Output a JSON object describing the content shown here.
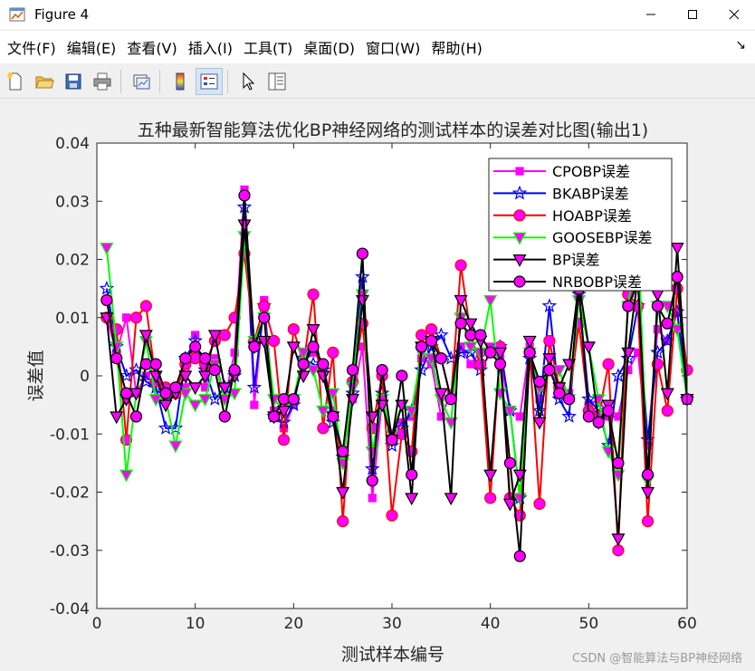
{
  "window": {
    "title": "Figure 4"
  },
  "menu": [
    "文件(F)",
    "编辑(E)",
    "查看(V)",
    "插入(I)",
    "工具(T)",
    "桌面(D)",
    "窗口(W)",
    "帮助(H)"
  ],
  "toolbar_icons": [
    "new-figure-icon",
    "open-file-icon",
    "save-icon",
    "print-icon",
    "link-plot-icon",
    "colorbar-icon",
    "legend-icon",
    "pointer-icon",
    "property-inspector-icon"
  ],
  "watermark": "CSDN @智能算法与BP神经网络",
  "chart_data": {
    "type": "line",
    "title": "五种最新智能算法优化BP神经网络的测试样本的误差对比图(输出1)",
    "xlabel": "测试样本编号",
    "ylabel": "误差值",
    "xlim": [
      0,
      60
    ],
    "ylim": [
      -0.04,
      0.04
    ],
    "xticks": [
      0,
      10,
      20,
      30,
      40,
      50,
      60
    ],
    "yticks": [
      -0.04,
      -0.03,
      -0.02,
      -0.01,
      0,
      0.01,
      0.02,
      0.03,
      0.04
    ],
    "ytick_labels": [
      "-0.04",
      "-0.03",
      "-0.02",
      "-0.01",
      "0",
      "0.01",
      "0.02",
      "0.03",
      "0.04"
    ],
    "grid": false,
    "legend_position": "top-right",
    "x": [
      1,
      2,
      3,
      4,
      5,
      6,
      7,
      8,
      9,
      10,
      11,
      12,
      13,
      14,
      15,
      16,
      17,
      18,
      19,
      20,
      21,
      22,
      23,
      24,
      25,
      26,
      27,
      28,
      29,
      30,
      31,
      32,
      33,
      34,
      35,
      36,
      37,
      38,
      39,
      40,
      41,
      42,
      43,
      44,
      45,
      46,
      47,
      48,
      49,
      50,
      51,
      52,
      53,
      54,
      55,
      56,
      57,
      58,
      59,
      60
    ],
    "series": [
      {
        "name": "CPOBP误差",
        "color": "#ff00ff",
        "marker": "square",
        "marker_fill": "#ff00ff",
        "values": [
          0.01,
          0.004,
          0.01,
          -0.003,
          0.0,
          0.002,
          -0.004,
          -0.003,
          -0.002,
          0.007,
          -0.002,
          0.003,
          -0.004,
          0.004,
          0.032,
          -0.005,
          0.013,
          -0.006,
          -0.009,
          -0.005,
          0.004,
          0.004,
          0.002,
          -0.006,
          -0.014,
          -0.004,
          0.005,
          -0.021,
          -0.004,
          -0.011,
          -0.008,
          -0.007,
          0.003,
          0.002,
          -0.007,
          -0.003,
          0.005,
          0.002,
          0.004,
          0.005,
          0.003,
          -0.006,
          -0.007,
          0.005,
          -0.004,
          0.001,
          -0.002,
          -0.003,
          0.009,
          -0.005,
          -0.004,
          -0.007,
          -0.007,
          0.001,
          0.004,
          -0.012,
          0.008,
          0.006,
          0.011,
          -0.004
        ]
      },
      {
        "name": "BKABP误差",
        "color": "#0000ff",
        "marker": "pentagram",
        "marker_fill": "none",
        "values": [
          0.015,
          0.005,
          0.0,
          0.001,
          -0.001,
          -0.002,
          -0.009,
          -0.009,
          0.003,
          0.006,
          0.001,
          -0.004,
          -0.002,
          0.0,
          0.029,
          -0.002,
          0.012,
          -0.007,
          -0.008,
          -0.005,
          0.003,
          0.002,
          0.001,
          -0.008,
          -0.014,
          -0.003,
          0.017,
          -0.016,
          -0.003,
          -0.012,
          -0.009,
          -0.006,
          0.001,
          0.005,
          0.007,
          0.003,
          0.004,
          0.004,
          0.001,
          0.004,
          0.005,
          -0.006,
          -0.021,
          0.003,
          -0.006,
          0.012,
          -0.004,
          -0.007,
          0.014,
          -0.004,
          -0.006,
          -0.012,
          0.0,
          0.003,
          0.012,
          -0.011,
          0.004,
          0.006,
          0.011,
          -0.004
        ]
      },
      {
        "name": "HOABP误差",
        "color": "#ff0000",
        "marker": "circle",
        "marker_fill": "#ff00ff",
        "values": [
          0.01,
          0.008,
          -0.011,
          0.01,
          0.012,
          -0.001,
          -0.002,
          -0.003,
          0.002,
          0.003,
          0.002,
          0.006,
          0.007,
          0.01,
          0.021,
          0.006,
          0.012,
          0.006,
          -0.011,
          0.008,
          0.002,
          0.014,
          -0.009,
          0.004,
          -0.025,
          -0.001,
          0.009,
          -0.009,
          0.0,
          -0.024,
          -0.01,
          -0.013,
          0.007,
          0.008,
          0.003,
          -0.004,
          0.019,
          0.007,
          0.002,
          -0.021,
          0.005,
          -0.021,
          -0.024,
          0.004,
          -0.022,
          0.006,
          -0.002,
          -0.004,
          0.009,
          -0.006,
          -0.007,
          0.002,
          -0.03,
          0.014,
          0.012,
          -0.025,
          0.002,
          -0.006,
          0.015,
          0.001
        ]
      },
      {
        "name": "GOOSEBP误差",
        "color": "#00ff00",
        "marker": "triangle-down",
        "marker_fill": "#ff00ff",
        "values": [
          0.022,
          0.005,
          -0.017,
          -0.003,
          0.006,
          -0.004,
          -0.004,
          -0.012,
          -0.003,
          -0.005,
          -0.004,
          0.002,
          -0.004,
          -0.003,
          0.024,
          0.006,
          0.01,
          -0.004,
          -0.006,
          -0.004,
          0.004,
          0.001,
          -0.006,
          -0.003,
          -0.015,
          -0.002,
          0.014,
          -0.013,
          -0.004,
          -0.01,
          -0.005,
          -0.006,
          0.004,
          0.003,
          -0.004,
          -0.008,
          0.01,
          0.005,
          0.004,
          0.013,
          -0.003,
          -0.006,
          -0.021,
          0.004,
          -0.002,
          0.001,
          0.001,
          -0.004,
          0.013,
          0.005,
          -0.004,
          -0.013,
          -0.017,
          0.012,
          0.024,
          -0.018,
          0.012,
          0.012,
          0.008,
          -0.004
        ]
      },
      {
        "name": "BP误差",
        "color": "#000000",
        "marker": "triangle-down",
        "marker_fill": "#ff00ff",
        "values": [
          0.01,
          -0.007,
          -0.004,
          -0.003,
          0.007,
          0.0,
          -0.005,
          -0.003,
          0.0,
          -0.002,
          0.0,
          0.007,
          -0.002,
          0.0,
          0.026,
          0.005,
          0.006,
          -0.007,
          -0.006,
          0.005,
          0.0,
          0.008,
          0.0,
          -0.007,
          -0.02,
          -0.004,
          0.013,
          -0.007,
          -0.005,
          -0.011,
          -0.005,
          -0.021,
          0.005,
          0.006,
          -0.003,
          -0.021,
          0.013,
          0.009,
          0.006,
          -0.017,
          0.004,
          -0.022,
          -0.017,
          0.006,
          -0.008,
          0.003,
          -0.002,
          0.002,
          0.016,
          0.005,
          -0.008,
          -0.005,
          -0.028,
          0.004,
          0.017,
          -0.02,
          0.014,
          -0.003,
          0.022,
          -0.004
        ]
      },
      {
        "name": "NRBOBP误差",
        "color": "#000000",
        "marker": "circle",
        "marker_fill": "#ff00ff",
        "values": [
          0.013,
          0.003,
          -0.003,
          -0.007,
          0.002,
          0.002,
          -0.003,
          -0.002,
          0.003,
          0.005,
          0.003,
          0.001,
          -0.007,
          0.001,
          0.031,
          0.005,
          0.01,
          -0.007,
          -0.004,
          -0.004,
          0.002,
          0.005,
          0.002,
          -0.007,
          -0.013,
          0.001,
          0.021,
          -0.018,
          0.001,
          -0.011,
          0.0,
          -0.017,
          0.005,
          0.006,
          0.003,
          -0.004,
          0.009,
          0.007,
          0.007,
          0.004,
          0.002,
          -0.015,
          -0.031,
          0.004,
          -0.001,
          0.001,
          -0.003,
          -0.004,
          0.015,
          -0.007,
          -0.008,
          -0.006,
          -0.015,
          0.012,
          0.016,
          -0.017,
          0.012,
          0.009,
          0.017,
          -0.004
        ]
      }
    ]
  }
}
